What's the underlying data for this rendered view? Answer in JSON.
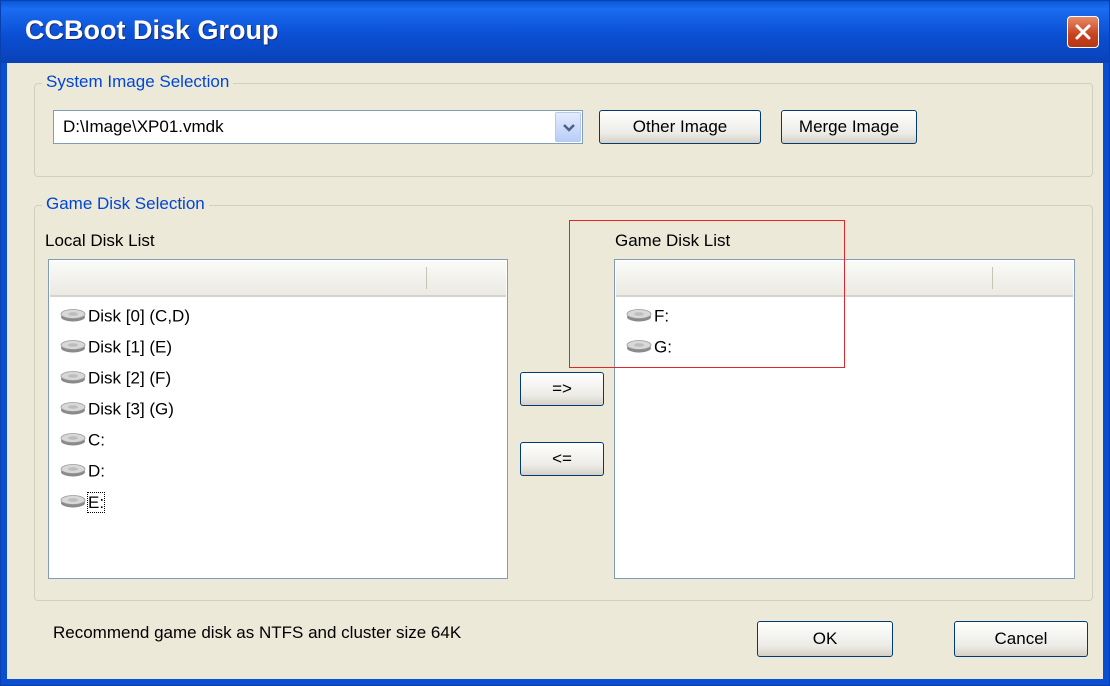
{
  "window": {
    "title": "CCBoot Disk Group"
  },
  "system_image": {
    "legend": "System Image Selection",
    "selected": "D:\\Image\\XP01.vmdk",
    "other_image_label": "Other Image",
    "merge_image_label": "Merge Image"
  },
  "game_disk": {
    "legend": "Game Disk Selection",
    "local_list_label": "Local Disk List",
    "game_list_label": "Game Disk List",
    "local_items": [
      "Disk [0] (C,D)",
      "Disk [1] (E)",
      "Disk [2] (F)",
      "Disk [3] (G)",
      "C:",
      "D:",
      "E:"
    ],
    "game_items": [
      "F:",
      "G:"
    ],
    "add_label": "=>",
    "remove_label": "<="
  },
  "footer": {
    "note": "Recommend game disk as NTFS and cluster size 64K",
    "ok_label": "OK",
    "cancel_label": "Cancel"
  },
  "colors": {
    "titlebar": "#0b4fd4",
    "legend": "#0046d5",
    "highlight_box": "#e0262a",
    "background": "#ece9d8"
  },
  "icons": {
    "disk": "hard-disk-icon",
    "close": "close-icon",
    "dropdown": "chevron-down-icon"
  }
}
